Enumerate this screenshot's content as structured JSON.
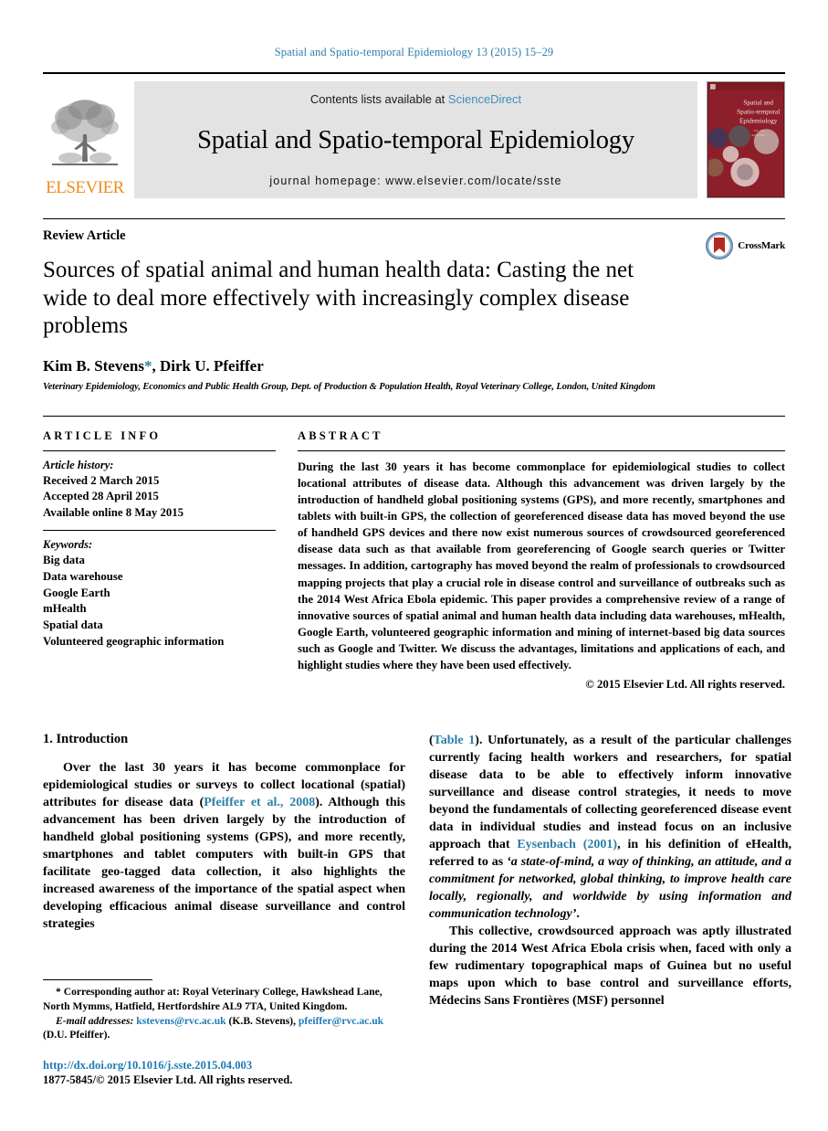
{
  "running_head": "Spatial and Spatio-temporal Epidemiology 13 (2015) 15–29",
  "masthead": {
    "publisher_name": "ELSEVIER",
    "contents_prefix": "Contents lists available at",
    "contents_link": "ScienceDirect",
    "journal_name": "Spatial and Spatio-temporal Epidemiology",
    "homepage": "journal homepage: www.elsevier.com/locate/sste",
    "cover_title_line1": "Spatial and",
    "cover_title_line2": "Spatio-temporal",
    "cover_title_line3": "Epidemiology"
  },
  "article": {
    "type": "Review Article",
    "title": "Sources of spatial animal and human health data: Casting the net wide to deal more effectively with increasingly complex disease problems",
    "authors_prefix": "Kim B. Stevens",
    "authors_star": "*",
    "authors_suffix": ", Dirk U. Pfeiffer",
    "affiliation": "Veterinary Epidemiology, Economics and Public Health Group, Dept. of Production & Population Health, Royal Veterinary College, London, United Kingdom",
    "crossmark_label": "CrossMark"
  },
  "info": {
    "heading": "ARTICLE INFO",
    "history_label": "Article history:",
    "history": [
      "Received 2 March 2015",
      "Accepted 28 April 2015",
      "Available online 8 May 2015"
    ],
    "keywords_label": "Keywords:",
    "keywords": [
      "Big data",
      "Data warehouse",
      "Google Earth",
      "mHealth",
      "Spatial data",
      "Volunteered geographic information"
    ]
  },
  "abstract": {
    "heading": "ABSTRACT",
    "text": "During the last 30 years it has become commonplace for epidemiological studies to collect locational attributes of disease data. Although this advancement was driven largely by the introduction of handheld global positioning systems (GPS), and more recently, smartphones and tablets with built-in GPS, the collection of georeferenced disease data has moved beyond the use of handheld GPS devices and there now exist numerous sources of crowdsourced georeferenced disease data such as that available from georeferencing of Google search queries or Twitter messages. In addition, cartography has moved beyond the realm of professionals to crowdsourced mapping projects that play a crucial role in disease control and surveillance of outbreaks such as the 2014 West Africa Ebola epidemic. This paper provides a comprehensive review of a range of innovative sources of spatial animal and human health data including data warehouses, mHealth, Google Earth, volunteered geographic information and mining of internet-based big data sources such as Google and Twitter. We discuss the advantages, limitations and applications of each, and highlight studies where they have been used effectively.",
    "copyright": "© 2015 Elsevier Ltd. All rights reserved."
  },
  "introduction": {
    "section_title": "1. Introduction",
    "left_p1_a": "Over the last 30 years it has become commonplace for epidemiological studies or surveys to collect locational (spatial) attributes for disease data (",
    "left_p1_cite": "Pfeiffer et al., 2008",
    "left_p1_b": "). Although this advancement has been driven largely by the introduction of handheld global positioning systems (GPS), and more recently, smartphones and tablet computers with built-in GPS that facilitate geo-tagged data collection, it also highlights the increased awareness of the importance of the spatial aspect when developing efficacious animal disease surveillance and control strategies",
    "right_p1_cite1": "Table 1",
    "right_p1_a": "). Unfortunately, as a result of the particular challenges currently facing health workers and researchers, for spatial disease data to be able to effectively inform innovative surveillance and disease control strategies, it needs to move beyond the fundamentals of collecting georeferenced disease event data in individual studies and instead focus on an inclusive approach that ",
    "right_p1_cite2": "Eysenbach",
    "right_p1_cite3": "(2001)",
    "right_p1_b": ", in his definition of eHealth, referred to as ",
    "right_quote": "‘a state-of-mind, a way of thinking, an attitude, and a commitment for networked, global thinking, to improve health care locally, regionally, and worldwide by using information and communication technology’",
    "right_p1_end": ".",
    "right_p2": "This collective, crowdsourced approach was aptly illustrated during the 2014 West Africa Ebola crisis when, faced with only a few rudimentary topographical maps of Guinea but no useful maps upon which to base control and surveillance efforts, Médecins Sans Frontières (MSF) personnel"
  },
  "footnotes": {
    "corresponding_star": "*",
    "corresponding": "Corresponding author at: Royal Veterinary College, Hawkshead Lane, North Mymms, Hatfield, Hertfordshire AL9 7TA, United Kingdom.",
    "email_label": "E-mail addresses:",
    "email1": "kstevens@rvc.ac.uk",
    "email1_owner": "(K.B. Stevens),",
    "email2": "pfeiffer@rvc.ac.uk",
    "email2_owner": "(D.U. Pfeiffer).",
    "doi": "http://dx.doi.org/10.1016/j.sste.2015.04.003",
    "issn": "1877-5845/© 2015 Elsevier Ltd. All rights reserved."
  },
  "colors": {
    "link": "#2b7fa8",
    "elsevier_orange": "#F08C1E",
    "cover_red": "#8d1f2a",
    "contents_bg": "#e3e3e3"
  }
}
